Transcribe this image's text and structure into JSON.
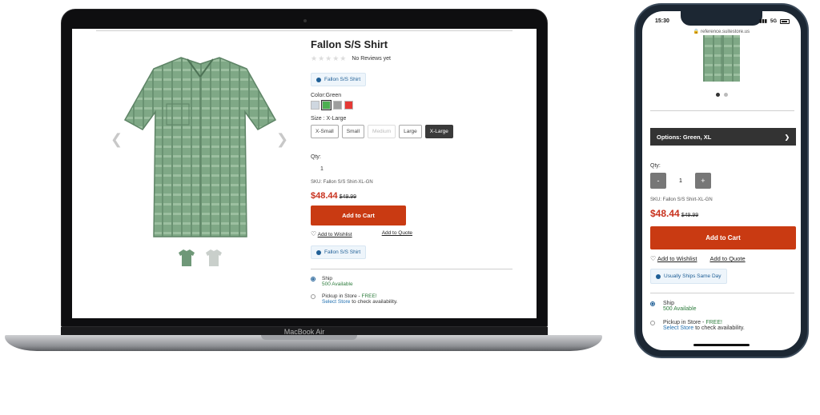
{
  "device": {
    "laptop_label": "MacBook Air"
  },
  "colors": {
    "accent": "#c93a12",
    "price": "#c8321e",
    "info": "#1f5f96",
    "dark_button": "#333333"
  },
  "icons": {
    "prev": "chevron-left-icon",
    "next": "chevron-right-icon",
    "info": "info-icon",
    "heart": "heart-icon",
    "options_arrow": "chevron-right-icon"
  },
  "product": {
    "title": "Fallon S/S Shirt",
    "reviews": "No Reviews yet",
    "badge": "Fallon S/S Shirt",
    "color_label": "Color:Green",
    "swatch_colors": [
      "#cfd7e0",
      "#4caf50",
      "#9e9e9e",
      "#e53935"
    ],
    "size_label": "Size : X-Large",
    "sizes": [
      {
        "label": "X-Small",
        "state": "normal"
      },
      {
        "label": "Small",
        "state": "normal"
      },
      {
        "label": "Medium",
        "state": "disabled"
      },
      {
        "label": "Large",
        "state": "normal"
      },
      {
        "label": "X-Large",
        "state": "selected"
      }
    ],
    "qty_label": "Qty:",
    "qty": "1",
    "sku": "SKU:  Fallon S/S Shirt-XL-GN",
    "price": "$48.44",
    "old_price": "$49.99",
    "add_to_cart": "Add to Cart",
    "wishlist": "Add to Wishlist",
    "quote": "Add to Quote",
    "badge2": "Fallon S/S Shirt",
    "ship_title": "Ship",
    "ship_avail": "500 Available",
    "pickup_title": "Pickup in Store - ",
    "pickup_free": "FREE!",
    "select_store": "Select Store",
    "select_store_suffix": " to check availability."
  },
  "mobile": {
    "time": "15:30",
    "signal": "5G",
    "url": "reference.suitestore.us",
    "options": "Options: Green, XL",
    "minus": "-",
    "plus": "+",
    "qty_label": "Qty:",
    "qty": "1",
    "sku": "SKU:  Fallon S/S Shirt-XL-GN",
    "price": "$48.44",
    "old_price": "$49.99",
    "add_to_cart": "Add to Cart",
    "wishlist": "Add to Wishlist",
    "quote": "Add to Quote",
    "ships_badge": "Usually Ships Same Day",
    "ship_title": "Ship",
    "ship_avail": "500 Available",
    "pickup_title": "Pickup in Store - ",
    "pickup_free": "FREE!",
    "select_store": "Select Store",
    "select_store_suffix": " to check availability."
  }
}
